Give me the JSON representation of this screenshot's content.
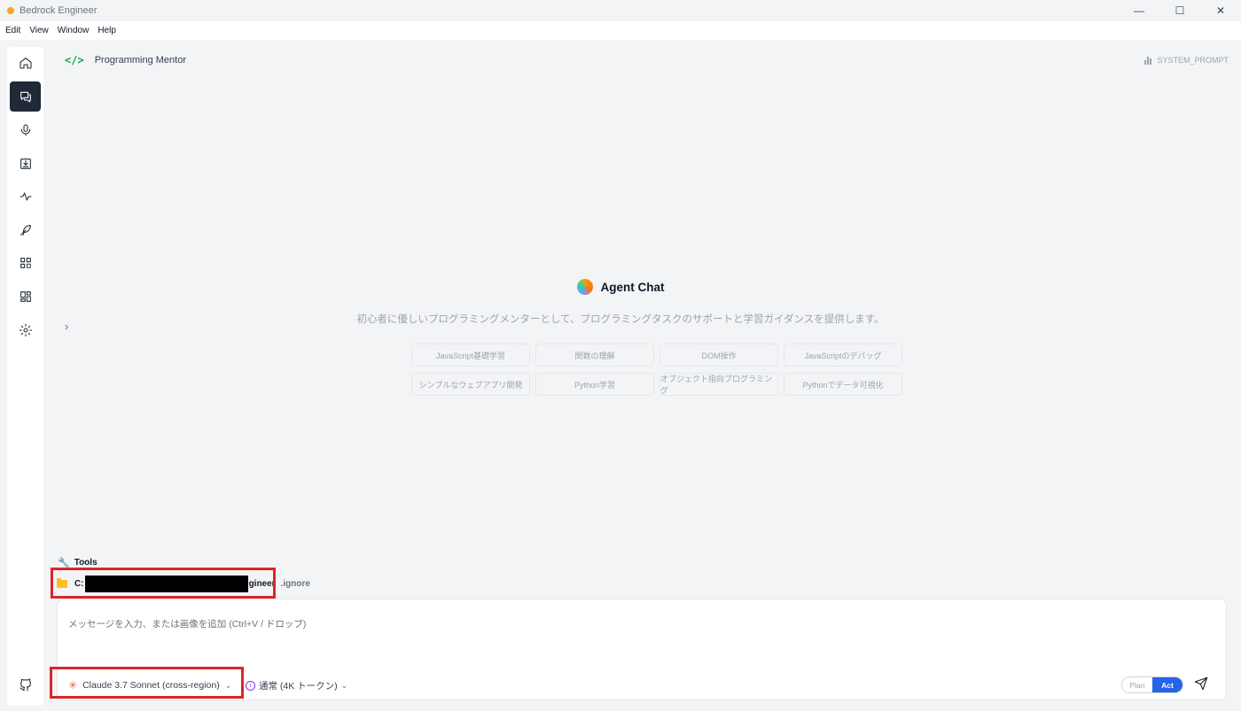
{
  "window": {
    "title": "Bedrock Engineer",
    "app_dot_color": "#f5a623",
    "minimize": "—",
    "maximize": "☐",
    "close": "✕"
  },
  "menu": [
    "Edit",
    "View",
    "Window",
    "Help"
  ],
  "sidebar": {
    "items": [
      {
        "name": "home-icon"
      },
      {
        "name": "chat-icon",
        "active": true
      },
      {
        "name": "microphone-icon"
      },
      {
        "name": "download-icon"
      },
      {
        "name": "activity-icon"
      },
      {
        "name": "feather-icon"
      },
      {
        "name": "apps-icon"
      },
      {
        "name": "layout-icon"
      },
      {
        "name": "gear-icon"
      }
    ],
    "bottom": {
      "name": "github-icon"
    }
  },
  "header": {
    "agent_name": "Programming Mentor",
    "system_prompt": "SYSTEM_PROMPT"
  },
  "center": {
    "title": "Agent Chat",
    "description": "初心者に優しいプログラミングメンターとして、プログラミングタスクのサポートと学習ガイダンスを提供します。",
    "examples": [
      "JavaScript基礎学習",
      "関数の理解",
      "DOM操作",
      "JavaScriptのデバッグ",
      "シンプルなウェブアプリ開発",
      "Python学習",
      "オブジェクト指向プログラミング",
      "Pythonでデータ可視化"
    ]
  },
  "tools": {
    "label": "Tools",
    "folder_prefix": "C:",
    "folder_suffix": "gineer",
    "ignore": ".ignore"
  },
  "input": {
    "placeholder": "メッセージを入力、または画像を追加 (Ctrl+V / ドロップ)",
    "model": "Claude 3.7 Sonnet (cross-region)",
    "thinking": "通常 (4K トークン)",
    "plan": "Plan",
    "act": "Act"
  },
  "colors": {
    "accent": "#2563eb",
    "highlight": "#dc2626",
    "code_icon": "#16a34a"
  }
}
